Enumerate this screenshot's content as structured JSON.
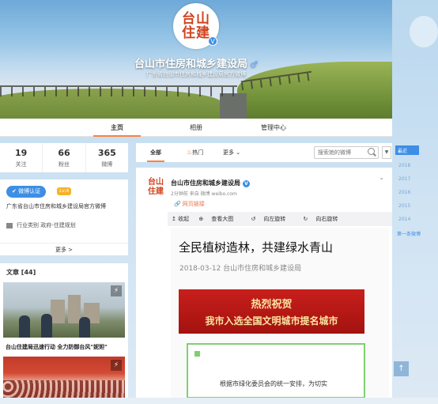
{
  "profile": {
    "avatar_text_1": "台山",
    "avatar_text_2": "住建",
    "name": "台山市住房和城乡建设局",
    "gender_icon": "♂",
    "description": "广东省台山市住房和城乡建设局官方微博"
  },
  "tabs": [
    {
      "label": "主页",
      "active": true
    },
    {
      "label": "相册",
      "active": false
    },
    {
      "label": "管理中心",
      "active": false
    }
  ],
  "stats": [
    {
      "num": "19",
      "label": "关注"
    },
    {
      "num": "66",
      "label": "粉丝"
    },
    {
      "num": "365",
      "label": "微博"
    }
  ],
  "about": {
    "verify_badge": "微博认证",
    "level": "Lv.4",
    "verify_text": "广东省台山市住房和城乡建设局官方微博",
    "industry": "行业类别  政府-住建规划",
    "more": "更多 >"
  },
  "articles": {
    "header": "文章 [44]",
    "item1_title": "台山住建局迅速行动 全力防御台风\"妮妲\""
  },
  "feed_filter": {
    "all": "全部",
    "hot": "热门",
    "more": "更多 ⌄",
    "search_placeholder": "搜索她的微博"
  },
  "post": {
    "avatar_1": "台山",
    "avatar_2": "住建",
    "author": "台山市住房和城乡建设局",
    "meta": "2分钟前 来自 微博 weibo.com",
    "link_label": "网页链接",
    "toolbar": [
      "↥ 收起",
      "查看大图",
      "向左旋转",
      "向右旋转"
    ],
    "article_title": "全民植树造林，共建绿水青山",
    "article_date": "2018-03-12  台山市住房和城乡建设局",
    "red_banner_1": "热烈祝贺",
    "red_banner_2": "我市入选全国文明城市提名城市",
    "body_text": "根据市绿化委员会的统一安排，为切实"
  },
  "timeline": {
    "header": "最近",
    "years": [
      "2018",
      "2017",
      "2016",
      "2015",
      "2014"
    ],
    "first": "第一条微博"
  },
  "colors": {
    "accent": "#ff8140",
    "verify_blue": "#3d8ee5",
    "link_orange": "#eb7350"
  }
}
